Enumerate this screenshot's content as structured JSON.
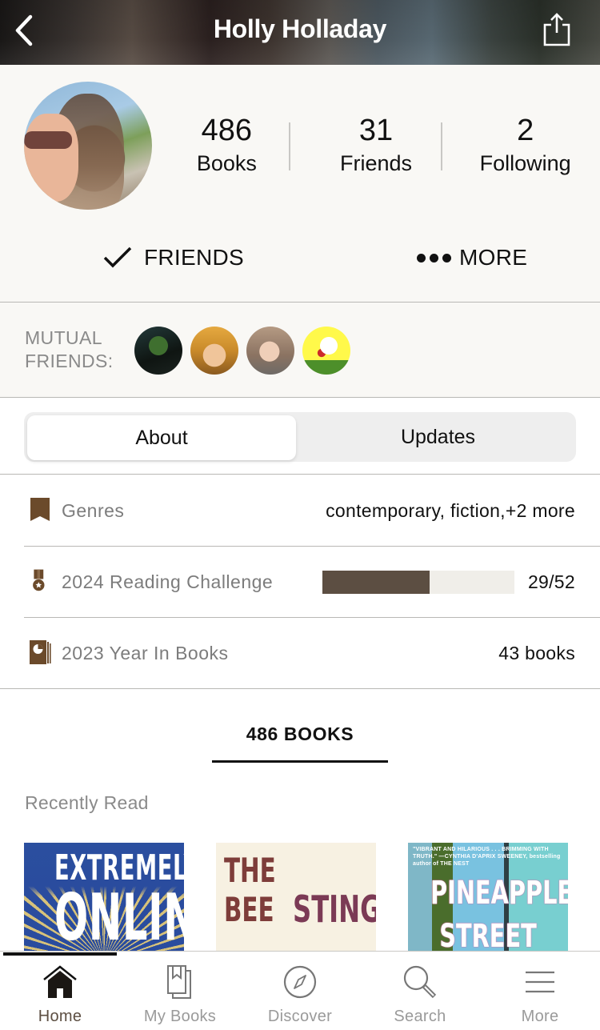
{
  "nav": {
    "title": "Holly Holladay",
    "back_icon": "chevron-left-icon",
    "share_icon": "share-icon"
  },
  "profile": {
    "avatar_alt": "Holly Holladay profile photo",
    "stats": [
      {
        "value": "486",
        "label": "Books"
      },
      {
        "value": "31",
        "label": "Friends"
      },
      {
        "value": "2",
        "label": "Following"
      }
    ],
    "friends_button": "FRIENDS",
    "more_button": "MORE"
  },
  "mutual_friends": {
    "label": "MUTUAL FRIENDS:",
    "count": 4
  },
  "segments": {
    "about": "About",
    "updates": "Updates",
    "selected": "About"
  },
  "about": {
    "genres": {
      "label": "Genres",
      "value": "contemporary, fiction,+2 more",
      "icon": "bookmark-icon"
    },
    "challenge": {
      "label": "2024 Reading Challenge",
      "value": "29/52",
      "read": 29,
      "goal": 52,
      "progress": 0.5577,
      "icon": "medal-icon"
    },
    "year_in_books": {
      "label": "2023 Year In Books",
      "value": "43 books",
      "icon": "year-in-books-icon"
    }
  },
  "books_tab": {
    "label": "486 BOOKS"
  },
  "recently_read": {
    "label": "Recently Read",
    "books": [
      {
        "cover_line1": "EXTREMELY",
        "cover_line2": "ONLINE"
      },
      {
        "cover_line1": "THE BEE",
        "cover_line2": "STING"
      },
      {
        "cover_blurb": "\"VIBRANT AND HILARIOUS . . . BRIMMING WITH TRUTH.\" —CYNTHIA D'APRIX SWEENEY, bestselling author of THE NEST",
        "cover_line1": "PINEAPPLE",
        "cover_line2": "STREET"
      }
    ]
  },
  "colors": {
    "accent_brown": "#5c4e42",
    "icon_brown": "#6b4a2b",
    "progress_track": "#f0eee9",
    "header_bg": "#f9f8f5"
  },
  "tabbar": {
    "items": [
      {
        "label": "Home",
        "icon": "home-icon",
        "active": true
      },
      {
        "label": "My Books",
        "icon": "my-books-icon",
        "active": false
      },
      {
        "label": "Discover",
        "icon": "compass-icon",
        "active": false
      },
      {
        "label": "Search",
        "icon": "search-icon",
        "active": false
      },
      {
        "label": "More",
        "icon": "menu-icon",
        "active": false
      }
    ]
  }
}
